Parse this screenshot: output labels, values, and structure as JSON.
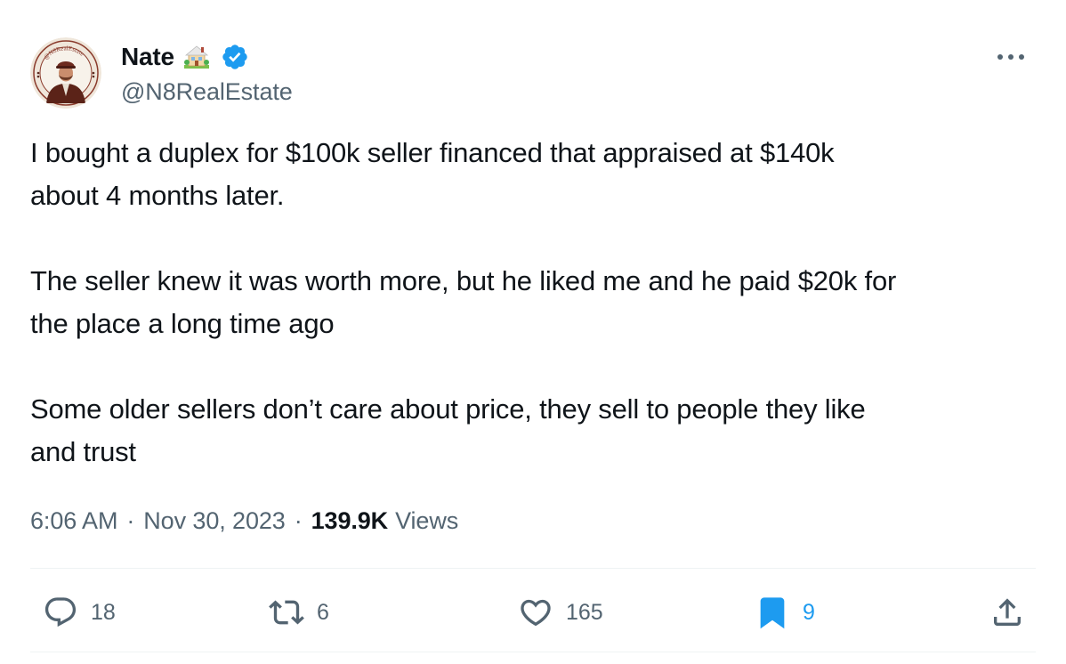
{
  "author": {
    "display_name": "Nate",
    "handle": "@N8RealEstate",
    "avatar_ring_text": "@N8RealEstate",
    "house_emoji_icon": "house-with-garden-icon",
    "verified_icon": "verified-badge-icon",
    "verified_color": "#1d9bf0"
  },
  "tweet": {
    "paragraphs": [
      "I bought a duplex for $100k seller financed that appraised at $140k\nabout 4 months later.",
      "The seller knew it was worth more, but he liked me and he paid $20k for\nthe place a long time ago",
      "Some older sellers don’t care about price, they sell to people they like\nand trust"
    ]
  },
  "meta": {
    "time": "6:06 AM",
    "separator": "·",
    "date": "Nov 30, 2023",
    "views_count": "139.9K",
    "views_label": "Views"
  },
  "actions": {
    "reply": {
      "icon": "reply-icon",
      "count": "18"
    },
    "retweet": {
      "icon": "retweet-icon",
      "count": "6"
    },
    "like": {
      "icon": "heart-icon",
      "count": "165"
    },
    "bookmark": {
      "icon": "bookmark-icon",
      "count": "9",
      "active": true
    },
    "share": {
      "icon": "share-icon"
    }
  },
  "colors": {
    "text_primary": "#0f1419",
    "text_secondary": "#536471",
    "accent_blue": "#1d9bf0",
    "divider": "#eff3f4"
  }
}
